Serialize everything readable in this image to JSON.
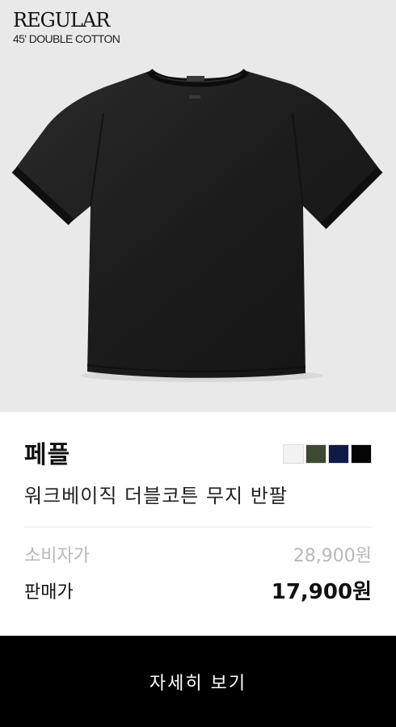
{
  "hero": {
    "fit": "REGULAR",
    "subtitle": "45' DOUBLE COTTON"
  },
  "product": {
    "brand": "페플",
    "name": "워크베이직 더블코튼 무지 반팔",
    "colors": [
      "#f2f2f2",
      "#3c4a32",
      "#101a4a",
      "#050505"
    ]
  },
  "pricing": {
    "msrp_label": "소비자가",
    "msrp_value": "28,900원",
    "sale_label": "판매가",
    "sale_value": "17,900원"
  },
  "cta": {
    "label": "자세히 보기"
  }
}
